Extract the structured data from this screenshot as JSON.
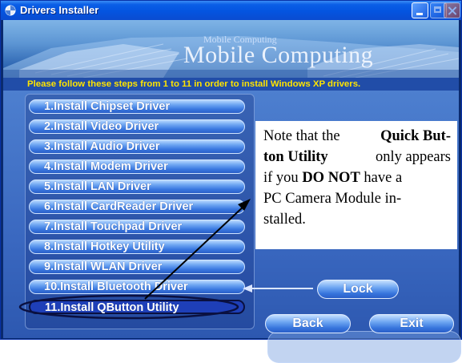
{
  "window": {
    "title": "Drivers Installer"
  },
  "banner": {
    "brand": "Mobile Computing",
    "brand_small": "Mobile Computing"
  },
  "instruction": "Please follow these steps from 1 to 11 in order to install Windows XP drivers.",
  "drivers": [
    {
      "label": "1.Install Chipset Driver"
    },
    {
      "label": "2.Install Video Driver"
    },
    {
      "label": "3.Install Audio Driver"
    },
    {
      "label": "4.Install Modem Driver"
    },
    {
      "label": "5.Install LAN Driver"
    },
    {
      "label": "6.Install CardReader Driver"
    },
    {
      "label": "7.Install Touchpad Driver"
    },
    {
      "label": "8.Install Hotkey Utility"
    },
    {
      "label": "9.Install WLAN Driver"
    },
    {
      "label": "10.Install Bluetooth Driver"
    },
    {
      "label": "11.Install QButton Utility",
      "highlighted": true
    }
  ],
  "buttons": {
    "lock": "Lock",
    "back": "Back",
    "exit": "Exit"
  },
  "note": {
    "l1_a": "Note that the ",
    "l1_b": "Quick But-",
    "l2_a": "ton Utility",
    "l2_b": " only appears",
    "l3_a": "if you ",
    "l3_b": "DO NOT",
    "l3_c": " have a",
    "l4": "PC Camera Module in-",
    "l5": "stalled."
  },
  "colors": {
    "instruction_text": "#ffe400",
    "title_bar": "#0454e0",
    "highlight_ring": "#0a1040"
  },
  "icons": {
    "app": "drivers-installer-icon"
  }
}
